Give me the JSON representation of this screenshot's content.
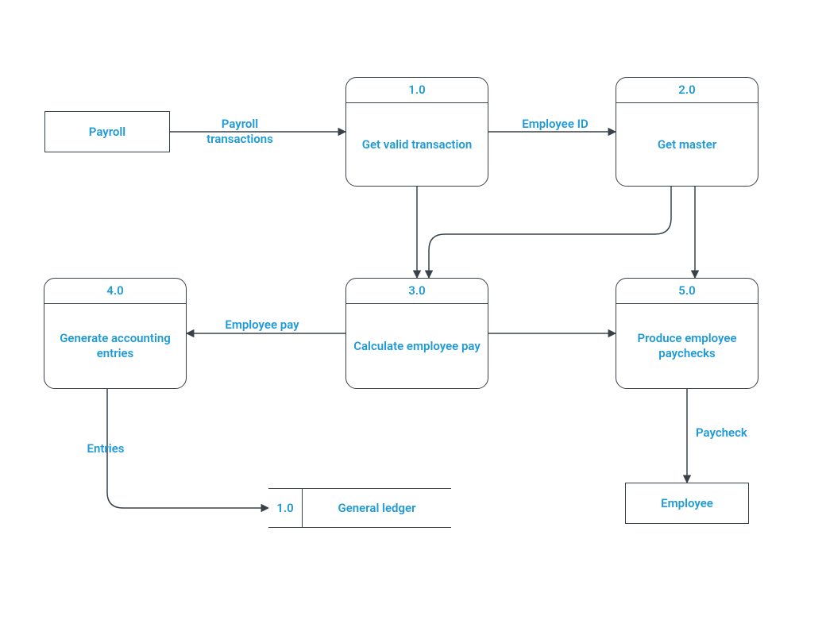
{
  "entities": {
    "payroll": "Payroll",
    "employee": "Employee"
  },
  "processes": {
    "p1": {
      "id": "1.0",
      "name": "Get valid transaction"
    },
    "p2": {
      "id": "2.0",
      "name": "Get master"
    },
    "p3": {
      "id": "3.0",
      "name": "Calculate employee pay"
    },
    "p4": {
      "id": "4.0",
      "name": "Generate accounting entries"
    },
    "p5": {
      "id": "5.0",
      "name": "Produce employee paychecks"
    }
  },
  "datastores": {
    "gl": {
      "id": "1.0",
      "name": "General ledger"
    }
  },
  "flows": {
    "payroll_trans": "Payroll transactions",
    "employee_id": "Employee ID",
    "employee_pay": "Employee pay",
    "paycheck": "Paycheck",
    "entries": "Entries"
  },
  "colors": {
    "text": "#1e9bd7",
    "stroke": "#384149"
  }
}
